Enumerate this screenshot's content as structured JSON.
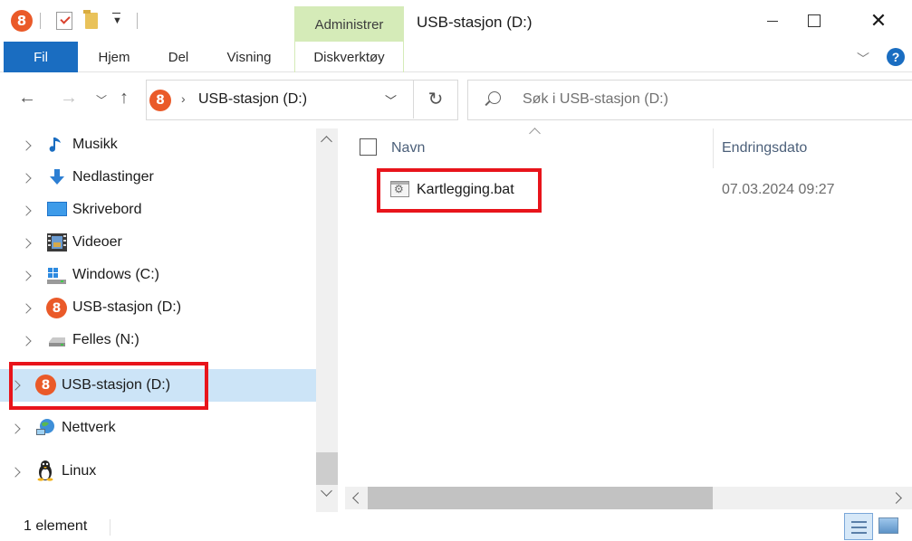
{
  "window": {
    "title": "USB-stasjon (D:)",
    "context_tab_header": "Administrer",
    "minimize": "",
    "close_glyph": "✕"
  },
  "ribbon": {
    "tabs": [
      "Fil",
      "Hjem",
      "Del",
      "Visning",
      "Diskverktøy"
    ],
    "active_tab": "Fil",
    "help": "?"
  },
  "address": {
    "path": "USB-stasjon (D:)",
    "search_placeholder": "Søk i USB-stasjon (D:)"
  },
  "navigation": {
    "items": [
      {
        "label": "Musikk",
        "icon": "music-icon"
      },
      {
        "label": "Nedlastinger",
        "icon": "download-icon"
      },
      {
        "label": "Skrivebord",
        "icon": "desktop-icon"
      },
      {
        "label": "Videoer",
        "icon": "video-icon"
      },
      {
        "label": "Windows (C:)",
        "icon": "windows-drive-icon"
      },
      {
        "label": "USB-stasjon (D:)",
        "icon": "usb-drive-icon"
      },
      {
        "label": "Felles (N:)",
        "icon": "network-drive-icon"
      },
      {
        "label": "USB-stasjon (D:)",
        "icon": "usb-drive-icon",
        "selected": true
      },
      {
        "label": "Nettverk",
        "icon": "network-icon"
      },
      {
        "label": "Linux",
        "icon": "linux-icon"
      }
    ]
  },
  "files": {
    "columns": {
      "name": "Navn",
      "date": "Endringsdato"
    },
    "rows": [
      {
        "name": "Kartlegging.bat",
        "date": "07.03.2024 09:27",
        "icon": "batch-file-icon"
      }
    ]
  },
  "status": {
    "count_text": "1 element"
  },
  "colors": {
    "accent": "#1a6dc1",
    "context_tab": "#d5ebb8",
    "selection": "#cce4f7",
    "highlight": "#e8141b",
    "brand": "#ea5a29"
  }
}
